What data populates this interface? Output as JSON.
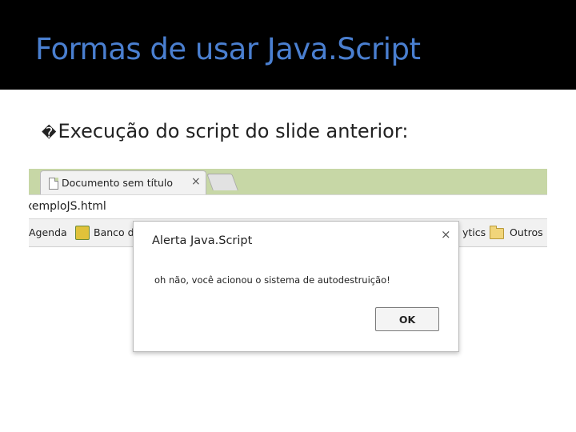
{
  "slide": {
    "title": "Formas de usar Java.Script",
    "bullet_glyph": "�",
    "bullet_text": "Execução do script do slide anterior:"
  },
  "browser": {
    "tab_title": "Documento sem título",
    "tab_close": "×",
    "url_text": "xemploJS.html",
    "bookmarks": {
      "agenda": "Agenda",
      "banco": "Banco d",
      "ytics": "ytics",
      "outros": "Outros"
    }
  },
  "dialog": {
    "title": "Alerta Java.Script",
    "close": "×",
    "message": "oh não, você acionou o sistema de autodestruição!",
    "ok_label": "OK"
  },
  "colors": {
    "title_blue": "#4a7fd0",
    "header_black": "#000000",
    "tab_strip_green": "#c7d7a6"
  },
  "icons": [
    "document-icon",
    "close-icon",
    "bookmark-icon",
    "folder-icon"
  ]
}
